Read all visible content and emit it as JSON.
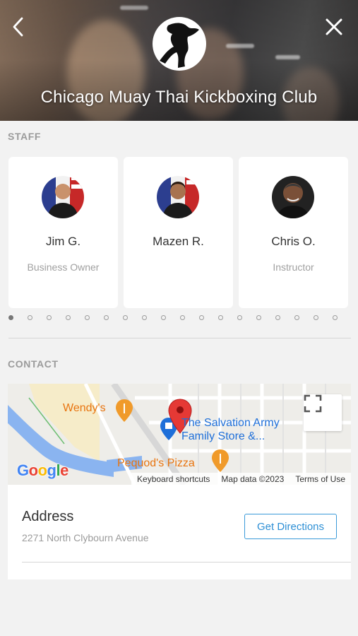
{
  "header": {
    "title": "Chicago Muay Thai Kickboxing Club",
    "back_icon": "chevron-left-icon",
    "close_icon": "close-icon"
  },
  "staff": {
    "label": "STAFF",
    "members": [
      {
        "name": "Jim G.",
        "role": "Business Owner"
      },
      {
        "name": "Mazen R.",
        "role": ""
      },
      {
        "name": "Chris O.",
        "role": "Instructor"
      }
    ]
  },
  "contact": {
    "label": "CONTACT",
    "map": {
      "places": [
        {
          "name": "Wendy's",
          "color": "#e8740f"
        },
        {
          "name": "The Salvation Army",
          "color": "#1e6fd9"
        },
        {
          "name": "Family Store &...",
          "color": "#1e6fd9"
        },
        {
          "name": "Pequod's Pizza",
          "color": "#e8740f"
        }
      ],
      "google": "Google",
      "footer": [
        "Keyboard shortcuts",
        "Map data ©2023",
        "Terms of Use"
      ]
    },
    "address_title": "Address",
    "address_value": "2271 North Clybourn Avenue",
    "directions_label": "Get Directions"
  },
  "colors": {
    "accent": "#2d8fd5",
    "pin": "#e53935"
  }
}
